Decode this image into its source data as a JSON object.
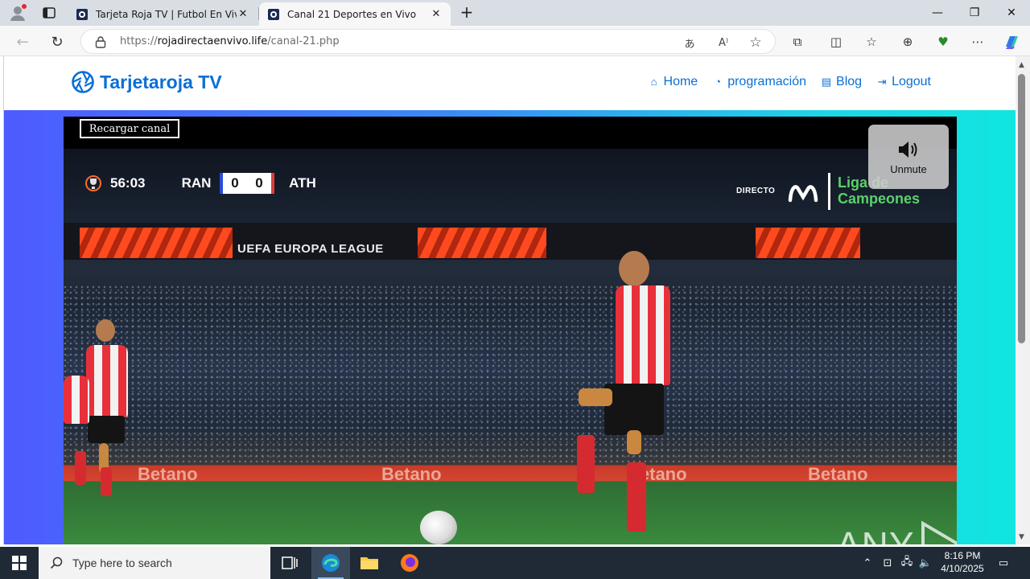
{
  "browser": {
    "tabs": [
      {
        "title": "Tarjeta Roja TV | Futbol En Vivo - ",
        "active": false
      },
      {
        "title": "Canal 21 Deportes en Vivo",
        "active": true
      }
    ],
    "url_prefix": "https://",
    "url_host": "rojadirectaenvivo.life",
    "url_path": "/canal-21.php"
  },
  "site": {
    "brand": "Tarjetaroja TV",
    "nav": [
      {
        "label": "Home",
        "icon": "home-icon"
      },
      {
        "label": "programación",
        "icon": "gauge-icon"
      },
      {
        "label": "Blog",
        "icon": "newspaper-icon"
      },
      {
        "label": "Logout",
        "icon": "logout-icon"
      }
    ],
    "colors": {
      "brand": "#0a6fd6",
      "band_left": "#4d5bff",
      "band_right": "#10e6e0"
    }
  },
  "player": {
    "reload_label": "Recargar canal",
    "unmute_label": "Unmute",
    "scoreboard": {
      "clock": "56:03",
      "home_team": "RAN",
      "home_score": "0",
      "away_score": "0",
      "away_team": "ATH"
    },
    "broadcast_live": "DIRECTO",
    "broadcaster_line1": "Liga de",
    "broadcaster_line2": "Campeones",
    "board_text": "UEFA EUROPA LEAGUE",
    "sponsor": "Betano",
    "watermark": "ANY RUN"
  },
  "taskbar": {
    "search_placeholder": "Type here to search",
    "time": "8:16 PM",
    "date": "4/10/2025"
  }
}
